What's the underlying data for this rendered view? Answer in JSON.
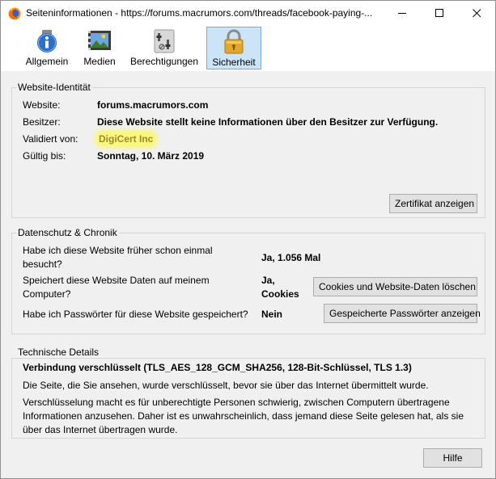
{
  "window": {
    "title": "Seiteninformationen - https://forums.macrumors.com/threads/facebook-paying-..."
  },
  "toolbar": {
    "tabs": [
      {
        "label": "Allgemein",
        "icon": "info-icon"
      },
      {
        "label": "Medien",
        "icon": "media-icon"
      },
      {
        "label": "Berechtigungen",
        "icon": "permissions-icon"
      },
      {
        "label": "Sicherheit",
        "icon": "padlock-icon",
        "active": true
      }
    ]
  },
  "identity": {
    "group_title": "Website-Identität",
    "website_label": "Website:",
    "website_value": "forums.macrumors.com",
    "owner_label": "Besitzer:",
    "owner_value": "Diese Website stellt keine Informationen über den Besitzer zur Verfügung.",
    "verified_label": "Validiert von:",
    "verified_value": "DigiCert Inc",
    "valid_label": "Gültig bis:",
    "valid_value": "Sonntag, 10. März 2019",
    "cert_button": "Zertifikat anzeigen"
  },
  "privacy": {
    "group_title": "Datenschutz & Chronik",
    "q1": "Habe ich diese Website früher schon einmal besucht?",
    "q1_answer": "Ja, 1.056 Mal",
    "q2": "Speichert diese Website Daten auf meinem Computer?",
    "q2_answer": "Ja, Cookies",
    "q2_button": "Cookies und Website-Daten löschen",
    "q3": "Habe ich Passwörter für diese Website gespeichert?",
    "q3_answer": "Nein",
    "q3_button": "Gespeicherte Passwörter anzeigen"
  },
  "technical": {
    "group_title": "Technische Details",
    "headline": "Verbindung verschlüsselt (TLS_AES_128_GCM_SHA256, 128-Bit-Schlüssel, TLS 1.3)",
    "para1": "Die Seite, die Sie ansehen, wurde verschlüsselt, bevor sie über das Internet übermittelt wurde.",
    "para2": "Verschlüsselung macht es für unberechtigte Personen schwierig, zwischen Computern übertragene Informationen anzusehen. Daher ist es unwahrscheinlich, dass jemand diese Seite gelesen hat, als sie über das Internet übertragen wurde."
  },
  "footer": {
    "help_button": "Hilfe"
  },
  "colors": {
    "highlight": "#fbf77c",
    "active_tab": "#cce4f7"
  }
}
